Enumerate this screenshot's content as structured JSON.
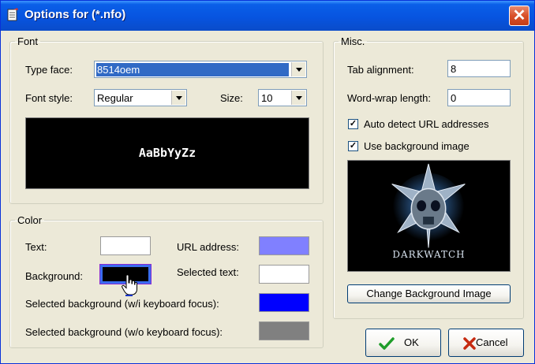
{
  "window": {
    "title": "Options for (*.nfo)",
    "close_glyph": "✕"
  },
  "font_group": {
    "legend": "Font",
    "typeface_label": "Type face:",
    "typeface_value": "8514oem",
    "style_label": "Font style:",
    "style_value": "Regular",
    "size_label": "Size:",
    "size_value": "10",
    "preview_text": "AaBbYyZz"
  },
  "color_group": {
    "legend": "Color",
    "text_label": "Text:",
    "background_label": "Background:",
    "url_label": "URL address:",
    "selected_text_label": "Selected text:",
    "sel_bg_focus_label": "Selected background (w/i keyboard focus):",
    "sel_bg_nofocus_label": "Selected background (w/o keyboard focus):",
    "colors": {
      "text": "#ffffff",
      "background": "#000000",
      "url": "#8080ff",
      "selected_text": "#ffffff",
      "sel_bg_focus": "#0000ff",
      "sel_bg_nofocus": "#808080"
    }
  },
  "misc_group": {
    "legend": "Misc.",
    "tab_label": "Tab alignment:",
    "tab_value": "8",
    "wrap_label": "Word-wrap length:",
    "wrap_value": "0",
    "auto_url_label": "Auto detect URL addresses",
    "use_bg_label": "Use background image",
    "auto_url_checked": true,
    "use_bg_checked": true,
    "bg_image_caption": "DARKWATCH",
    "change_bg_button": "Change Background Image"
  },
  "buttons": {
    "ok": "OK",
    "cancel": "Cancel"
  },
  "icons": {
    "app": "notepad-icon",
    "close": "close-icon",
    "ok": "check-icon",
    "cancel": "x-icon",
    "cursor": "hand-cursor-icon"
  }
}
